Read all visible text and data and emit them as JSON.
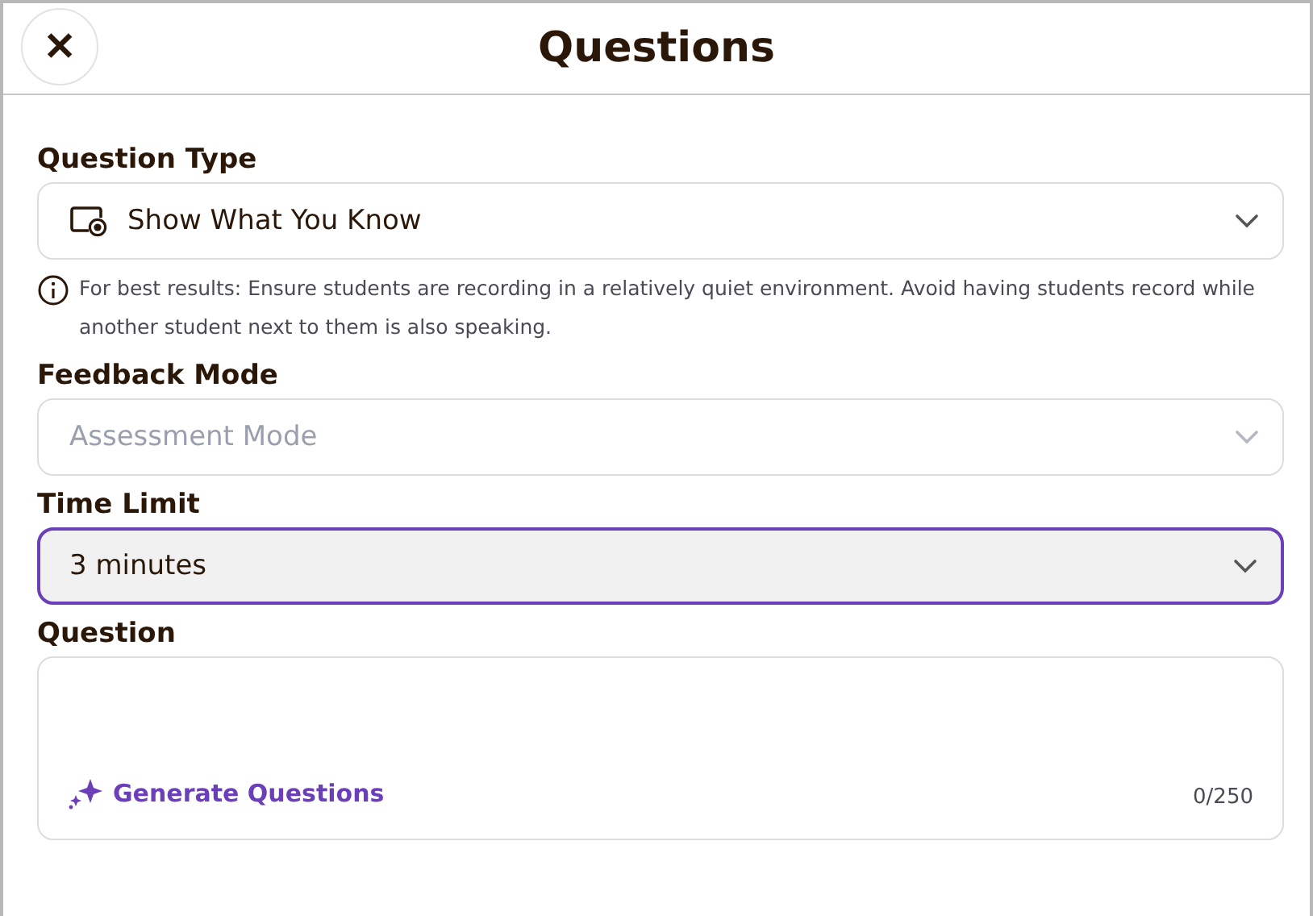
{
  "header": {
    "title": "Questions",
    "close_label": "✕"
  },
  "fields": [
    {
      "kind": "select",
      "label": "Question Type",
      "value": "Show What You Know",
      "icon": true,
      "disabled": false,
      "focused": false,
      "note": "For best results: Ensure students are recording in a relatively quiet environment. Avoid having students record while another student next to them is also speaking."
    },
    {
      "kind": "select",
      "label": "Feedback Mode",
      "value": "Assessment Mode",
      "icon": false,
      "disabled": true,
      "focused": false
    },
    {
      "kind": "select",
      "label": "Time Limit",
      "value": "3 minutes",
      "icon": false,
      "disabled": false,
      "focused": true
    },
    {
      "kind": "textarea",
      "label": "Question",
      "action": "Generate Questions",
      "count": "0/250"
    }
  ]
}
